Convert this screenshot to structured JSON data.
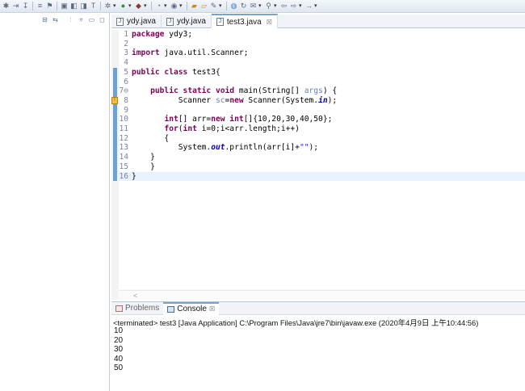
{
  "toolbar": {
    "icons": [
      "debug-icon",
      "run-icon",
      "new-icon",
      "save-icon",
      "print-icon",
      "search-icon",
      "open-type-icon",
      "task-icon",
      "external-tools-icon",
      "back-icon",
      "forward-icon"
    ]
  },
  "editor": {
    "tabs": [
      {
        "label": "ydy.java",
        "active": false
      },
      {
        "label": "ydy.java",
        "active": false
      },
      {
        "label": "test3.java",
        "active": true
      }
    ],
    "tab_close": "☒",
    "lines": [
      {
        "n": "1",
        "html": "<span class=\"kw\">package</span> ydy3;"
      },
      {
        "n": "2",
        "html": ""
      },
      {
        "n": "3",
        "html": "<span class=\"kw\">import</span> java.util.Scanner;"
      },
      {
        "n": "4",
        "html": ""
      },
      {
        "n": "5",
        "html": "<span class=\"kw\">public class</span> test3{"
      },
      {
        "n": "6",
        "html": ""
      },
      {
        "n": "7⊖",
        "html": "    <span class=\"kw\">public static void</span> main(String[] <span class=\"unused\">args</span>) {"
      },
      {
        "n": "8",
        "html": "          Scanner <span class=\"unused\">sc</span>=<span class=\"kw\">new</span> Scanner(System.<span class=\"fld\">in</span>);"
      },
      {
        "n": "9",
        "html": ""
      },
      {
        "n": "10",
        "html": "       <span class=\"kw\">int</span>[] arr=<span class=\"kw\">new int</span>[]{10,20,30,40,50};"
      },
      {
        "n": "11",
        "html": "       <span class=\"kw\">for</span>(<span class=\"kw\">int</span> i=0;i&lt;arr.length;i++)"
      },
      {
        "n": "12",
        "html": "       {"
      },
      {
        "n": "13",
        "html": "          System.<span class=\"fld\">out</span>.println(arr[i]+<span class=\"str\">\"\"</span>);"
      },
      {
        "n": "14",
        "html": "    }"
      },
      {
        "n": "15",
        "html": "    }"
      },
      {
        "n": "16",
        "html": "}"
      }
    ]
  },
  "console": {
    "tabs": [
      {
        "label": "Problems",
        "active": false
      },
      {
        "label": "Console",
        "active": true
      }
    ],
    "close": "☒",
    "terminated": "<terminated> test3 [Java Application] C:\\Program Files\\Java\\jre7\\bin\\javaw.exe (2020年4月9日 上午10:44:56)",
    "output": [
      "10",
      "20",
      "30",
      "40",
      "50"
    ]
  },
  "colors": {
    "keyword": "#7f0055",
    "field": "#0000c0",
    "string": "#2a00ff",
    "line_number": "#7f7f9f",
    "current_line": "#e8f2fe"
  }
}
